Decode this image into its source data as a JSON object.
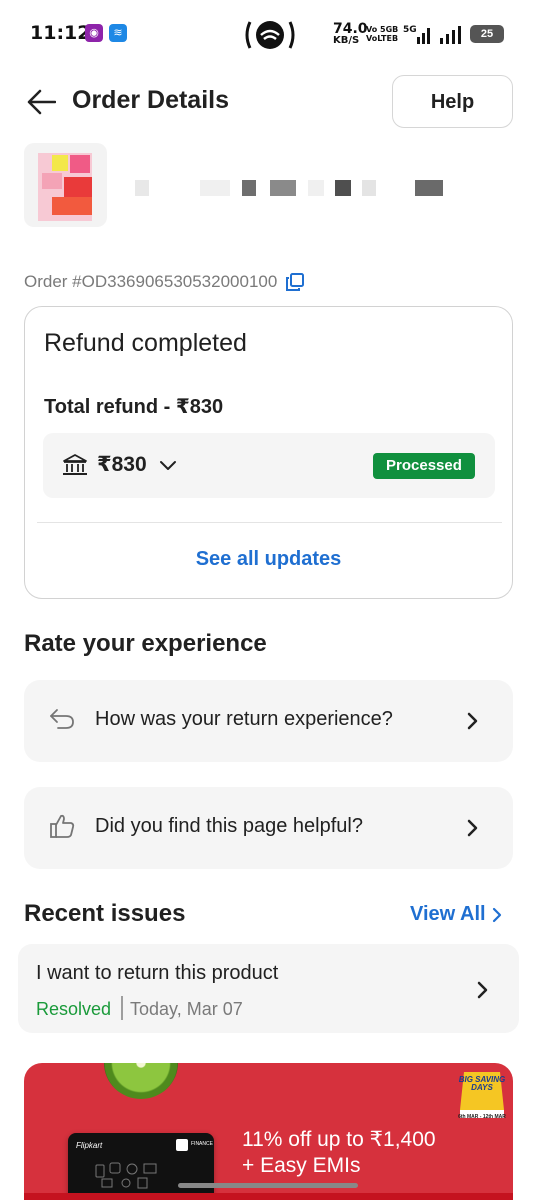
{
  "status_bar": {
    "time": "11:12",
    "net_speed_value": "74.0",
    "net_speed_unit": "KB/S",
    "volte1": "Vo 5GB",
    "volte2": "VoLTEB",
    "network": "5G",
    "battery": "25"
  },
  "header": {
    "title": "Order Details",
    "help_label": "Help"
  },
  "order": {
    "id_text": "Order #OD336906530532000100"
  },
  "refund": {
    "title": "Refund completed",
    "total_label": "Total refund - ₹830",
    "amount": "₹830",
    "status": "Processed",
    "see_all": "See all updates"
  },
  "rate": {
    "section_title": "Rate your experience",
    "items": [
      {
        "label": "How was your return experience?",
        "icon": "return-arrow-icon"
      },
      {
        "label": "Did you find this page helpful?",
        "icon": "thumbs-up-icon"
      }
    ]
  },
  "recent_issues": {
    "section_title": "Recent issues",
    "view_all": "View All",
    "items": [
      {
        "title": "I want to return this product",
        "status": "Resolved",
        "date": "Today, Mar 07"
      }
    ]
  },
  "promo": {
    "line1": "11% off up to ₹1,400",
    "line2": "+ Easy EMIs",
    "card_brand": "Flipkart",
    "card_finance": "FINANCE",
    "badge_text": "BIG SAVING DAYS",
    "badge_dates": "6th MAR - 12th MAR"
  },
  "colors": {
    "accent_blue": "#1f6fd1",
    "success_green": "#10903e",
    "banner_red": "#d6313d"
  }
}
